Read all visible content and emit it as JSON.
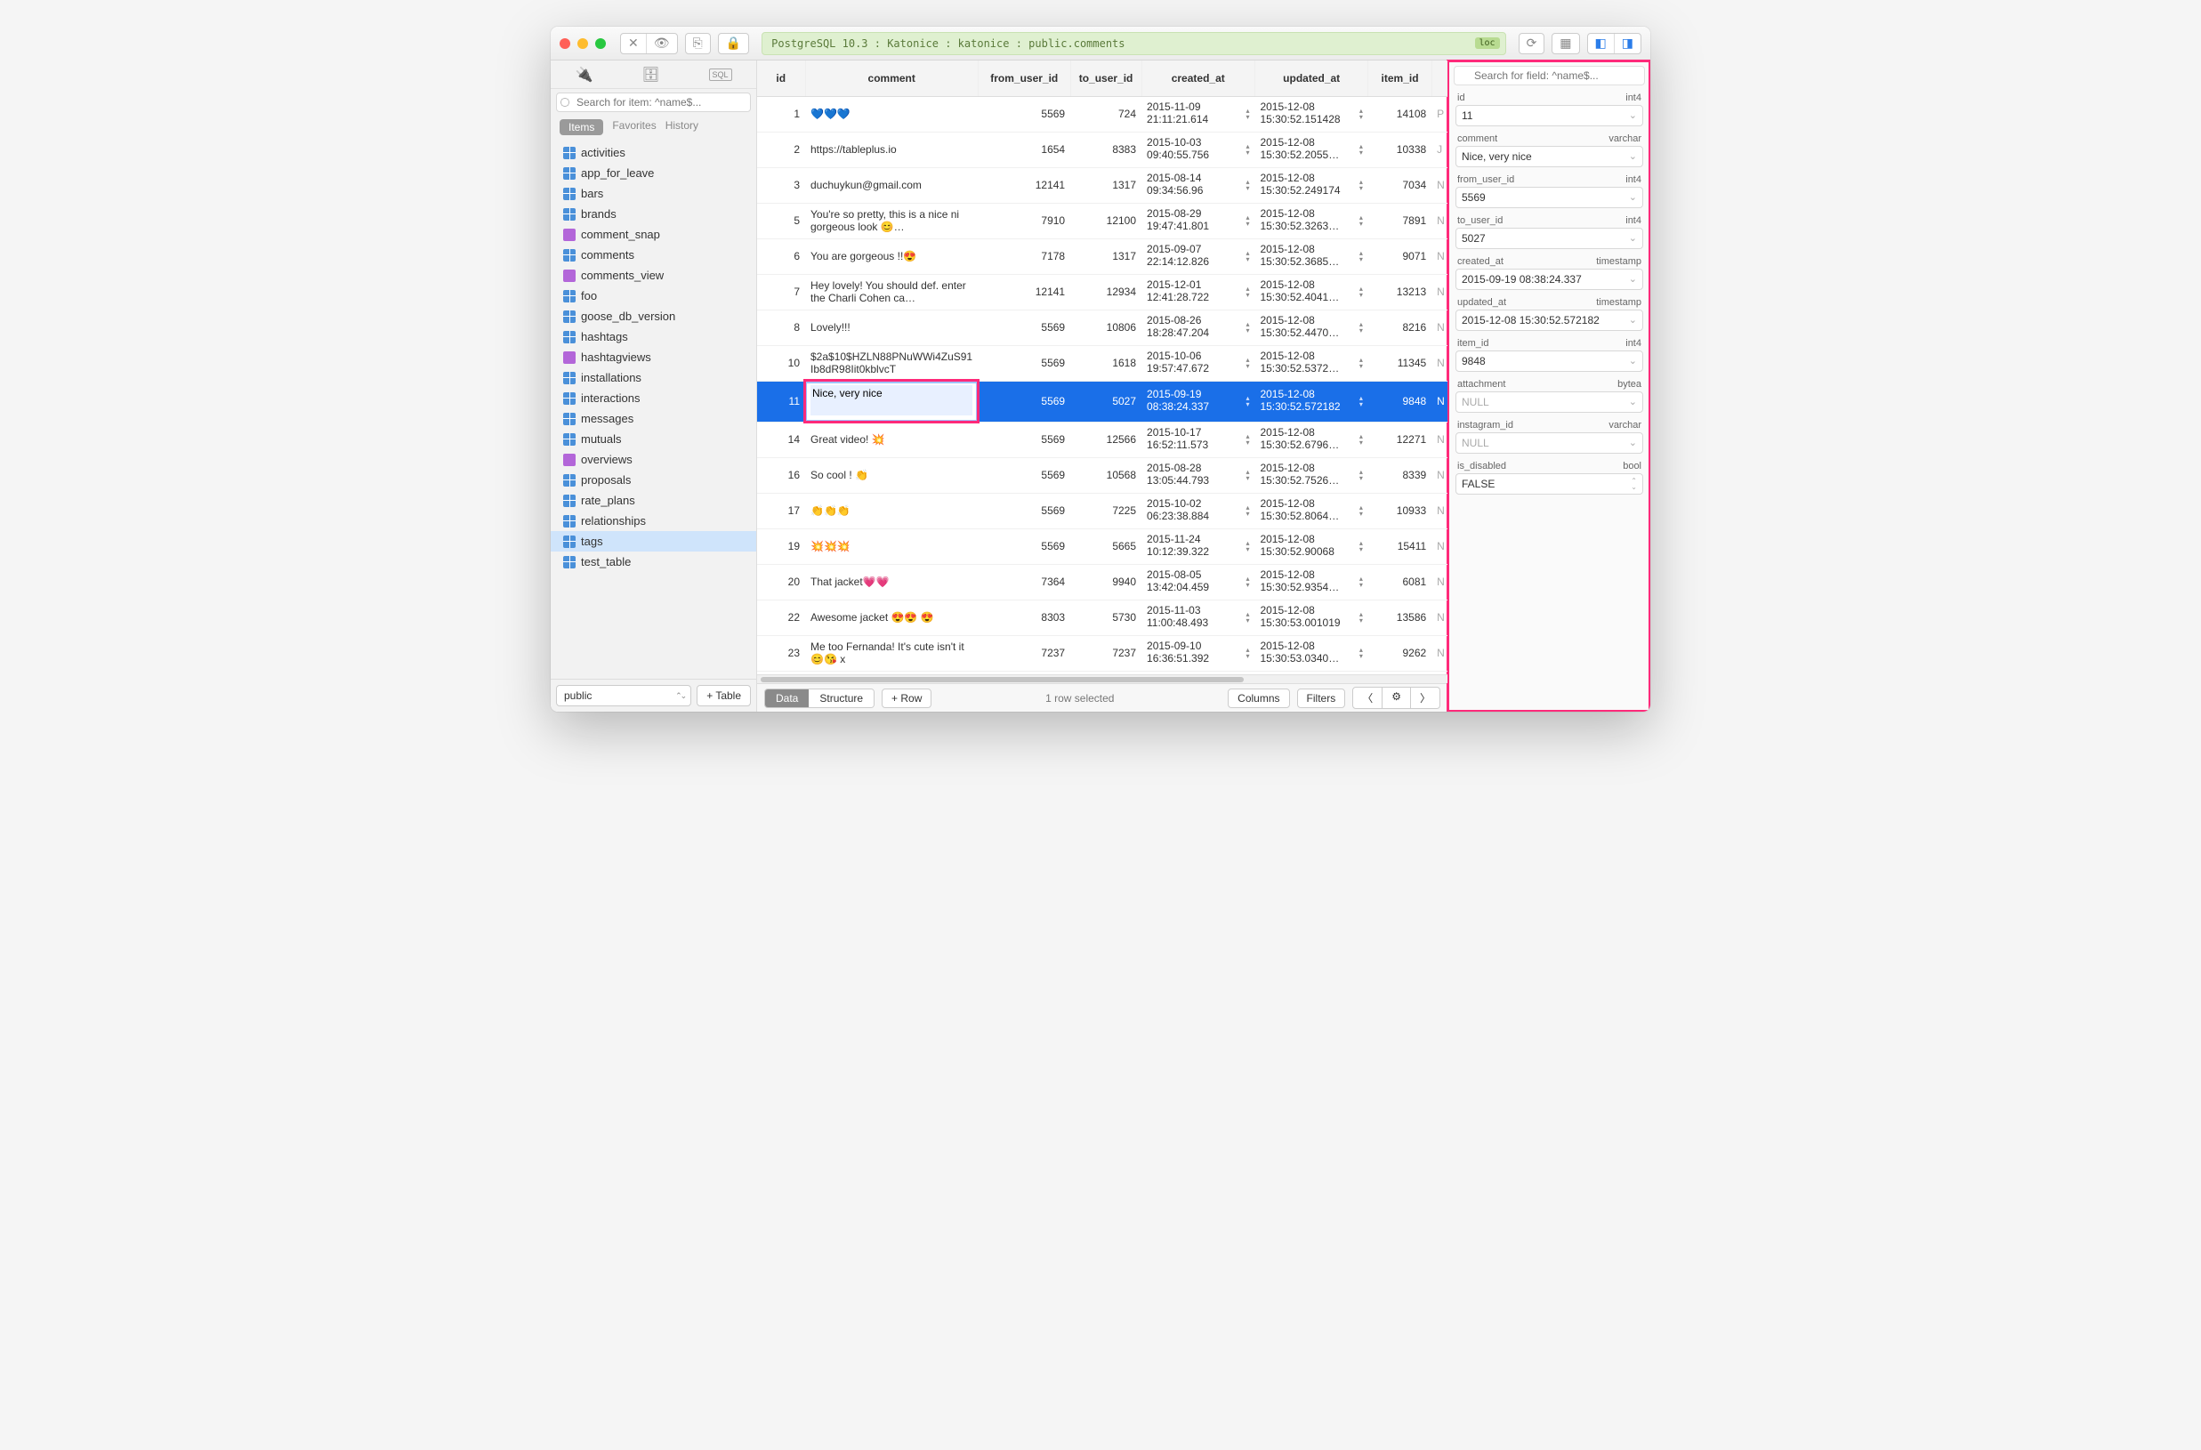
{
  "titlebar": {
    "path": "PostgreSQL 10.3 : Katonice : katonice : public.comments",
    "loc_badge": "loc"
  },
  "sidebar": {
    "search_placeholder": "Search for item: ^name$...",
    "tabs": {
      "items": "Items",
      "favorites": "Favorites",
      "history": "History"
    },
    "items": [
      {
        "label": "activities",
        "view": false
      },
      {
        "label": "app_for_leave",
        "view": false
      },
      {
        "label": "bars",
        "view": false
      },
      {
        "label": "brands",
        "view": false
      },
      {
        "label": "comment_snap",
        "view": true
      },
      {
        "label": "comments",
        "view": false
      },
      {
        "label": "comments_view",
        "view": true
      },
      {
        "label": "foo",
        "view": false
      },
      {
        "label": "goose_db_version",
        "view": false
      },
      {
        "label": "hashtags",
        "view": false
      },
      {
        "label": "hashtagviews",
        "view": true
      },
      {
        "label": "installations",
        "view": false
      },
      {
        "label": "interactions",
        "view": false
      },
      {
        "label": "messages",
        "view": false
      },
      {
        "label": "mutuals",
        "view": false
      },
      {
        "label": "overviews",
        "view": true
      },
      {
        "label": "proposals",
        "view": false
      },
      {
        "label": "rate_plans",
        "view": false
      },
      {
        "label": "relationships",
        "view": false
      },
      {
        "label": "tags",
        "view": false,
        "selected": true
      },
      {
        "label": "test_table",
        "view": false
      }
    ],
    "schema_select": "public",
    "add_table": "+ Table"
  },
  "grid": {
    "columns": [
      "id",
      "comment",
      "from_user_id",
      "to_user_id",
      "created_at",
      "updated_at",
      "item_id",
      ""
    ],
    "rows": [
      {
        "id": "1",
        "comment": "💙💙💙",
        "from": "5569",
        "to": "724",
        "created": "2015-11-09 21:11:21.614",
        "updated": "2015-12-08 15:30:52.151428",
        "item": "14108",
        "extra": "P"
      },
      {
        "id": "2",
        "comment": "https://tableplus.io",
        "from": "1654",
        "to": "8383",
        "created": "2015-10-03 09:40:55.756",
        "updated": "2015-12-08 15:30:52.2055…",
        "item": "10338",
        "extra": "J"
      },
      {
        "id": "3",
        "comment": "duchuykun@gmail.com",
        "from": "12141",
        "to": "1317",
        "created": "2015-08-14 09:34:56.96",
        "updated": "2015-12-08 15:30:52.249174",
        "item": "7034",
        "extra": "N"
      },
      {
        "id": "5",
        "comment": "You're so pretty, this is a nice ni gorgeous look 😊…",
        "from": "7910",
        "to": "12100",
        "created": "2015-08-29 19:47:41.801",
        "updated": "2015-12-08 15:30:52.3263…",
        "item": "7891",
        "extra": "N"
      },
      {
        "id": "6",
        "comment": "You are gorgeous !!😍",
        "from": "7178",
        "to": "1317",
        "created": "2015-09-07 22:14:12.826",
        "updated": "2015-12-08 15:30:52.3685…",
        "item": "9071",
        "extra": "N"
      },
      {
        "id": "7",
        "comment": "Hey lovely! You should def. enter the Charli Cohen ca…",
        "from": "12141",
        "to": "12934",
        "created": "2015-12-01 12:41:28.722",
        "updated": "2015-12-08 15:30:52.4041…",
        "item": "13213",
        "extra": "N"
      },
      {
        "id": "8",
        "comment": "Lovely!!!",
        "from": "5569",
        "to": "10806",
        "created": "2015-08-26 18:28:47.204",
        "updated": "2015-12-08 15:30:52.4470…",
        "item": "8216",
        "extra": "N"
      },
      {
        "id": "10",
        "comment": "$2a$10$HZLN88PNuWWi4ZuS91Ib8dR98Iit0kblvcT",
        "from": "5569",
        "to": "1618",
        "created": "2015-10-06 19:57:47.672",
        "updated": "2015-12-08 15:30:52.5372…",
        "item": "11345",
        "extra": "N"
      },
      {
        "id": "11",
        "comment": "Nice, very nice",
        "from": "5569",
        "to": "5027",
        "created": "2015-09-19 08:38:24.337",
        "updated": "2015-12-08 15:30:52.572182",
        "item": "9848",
        "extra": "N",
        "selected": true,
        "editing": true
      },
      {
        "id": "14",
        "comment": "Great video! 💥",
        "from": "5569",
        "to": "12566",
        "created": "2015-10-17 16:52:11.573",
        "updated": "2015-12-08 15:30:52.6796…",
        "item": "12271",
        "extra": "N"
      },
      {
        "id": "16",
        "comment": "So cool ! 👏",
        "from": "5569",
        "to": "10568",
        "created": "2015-08-28 13:05:44.793",
        "updated": "2015-12-08 15:30:52.7526…",
        "item": "8339",
        "extra": "N"
      },
      {
        "id": "17",
        "comment": "👏👏👏",
        "from": "5569",
        "to": "7225",
        "created": "2015-10-02 06:23:38.884",
        "updated": "2015-12-08 15:30:52.8064…",
        "item": "10933",
        "extra": "N"
      },
      {
        "id": "19",
        "comment": "💥💥💥",
        "from": "5569",
        "to": "5665",
        "created": "2015-11-24 10:12:39.322",
        "updated": "2015-12-08 15:30:52.90068",
        "item": "15411",
        "extra": "N"
      },
      {
        "id": "20",
        "comment": "That jacket💗💗",
        "from": "7364",
        "to": "9940",
        "created": "2015-08-05 13:42:04.459",
        "updated": "2015-12-08 15:30:52.9354…",
        "item": "6081",
        "extra": "N"
      },
      {
        "id": "22",
        "comment": "Awesome jacket 😍😍 😍",
        "from": "8303",
        "to": "5730",
        "created": "2015-11-03 11:00:48.493",
        "updated": "2015-12-08 15:30:53.001019",
        "item": "13586",
        "extra": "N"
      },
      {
        "id": "23",
        "comment": "Me too Fernanda! It's cute isn't it 😊😘 x",
        "from": "7237",
        "to": "7237",
        "created": "2015-09-10 16:36:51.392",
        "updated": "2015-12-08 15:30:53.0340…",
        "item": "9262",
        "extra": "N"
      }
    ]
  },
  "footer": {
    "data": "Data",
    "structure": "Structure",
    "row": "+  Row",
    "status": "1 row selected",
    "columns": "Columns",
    "filters": "Filters"
  },
  "inspector": {
    "search_placeholder": "Search for field: ^name$...",
    "fields": [
      {
        "name": "id",
        "type": "int4",
        "value": "11"
      },
      {
        "name": "comment",
        "type": "varchar",
        "value": "Nice, very nice"
      },
      {
        "name": "from_user_id",
        "type": "int4",
        "value": "5569"
      },
      {
        "name": "to_user_id",
        "type": "int4",
        "value": "5027"
      },
      {
        "name": "created_at",
        "type": "timestamp",
        "value": "2015-09-19 08:38:24.337"
      },
      {
        "name": "updated_at",
        "type": "timestamp",
        "value": "2015-12-08 15:30:52.572182"
      },
      {
        "name": "item_id",
        "type": "int4",
        "value": "9848"
      },
      {
        "name": "attachment",
        "type": "bytea",
        "value": "NULL",
        "null": true
      },
      {
        "name": "instagram_id",
        "type": "varchar",
        "value": "NULL",
        "null": true
      },
      {
        "name": "is_disabled",
        "type": "bool",
        "value": "FALSE",
        "stepper": true
      }
    ]
  }
}
